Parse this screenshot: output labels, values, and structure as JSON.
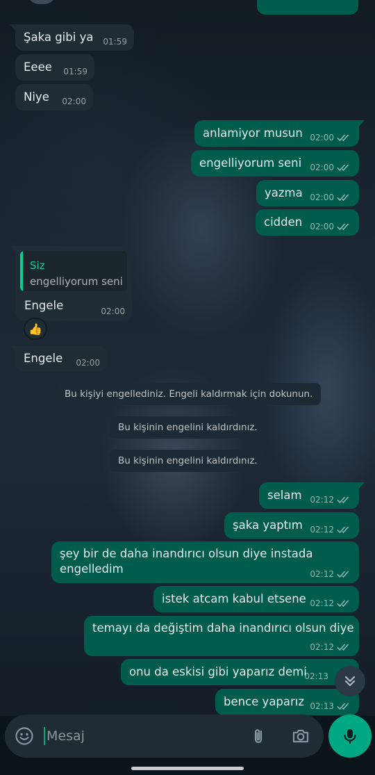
{
  "messages": [
    {
      "text": "Şaka gibi ya",
      "time": "01:59"
    },
    {
      "text": "Eeee",
      "time": "01:59"
    },
    {
      "text": "Niye",
      "time": "02:00"
    },
    {
      "text": "anlamiyor musun",
      "time": "02:00"
    },
    {
      "text": "engelliyorum seni",
      "time": "02:00"
    },
    {
      "text": "yazma",
      "time": "02:00"
    },
    {
      "text": "cidden",
      "time": "02:00"
    },
    {
      "quote_author": "Siz",
      "quote_text": "engelliyorum seni",
      "text": "Engele",
      "time": "02:00",
      "reaction": "👍"
    },
    {
      "text": "Engele",
      "time": "02:00"
    },
    {
      "text": "selam",
      "time": "02:12"
    },
    {
      "text": "şaka yaptım",
      "time": "02:12"
    },
    {
      "text": "şey bir de daha inandırıcı olsun diye instada engelledim",
      "line1": "şey bir de daha inandırıcı olsun diye instada",
      "line2": "engelledim",
      "time": "02:12"
    },
    {
      "text": "istek atcam kabul etsene",
      "time": "02:12"
    },
    {
      "text": "temayı da değiştim daha inandırıcı olsun diye",
      "time": "02:12"
    },
    {
      "text": "onu da eskisi gibi yaparız demi",
      "time": "02:13"
    },
    {
      "text": "bence yaparız",
      "time": "02:13"
    }
  ],
  "system_notices": [
    "Bu kişiyi engellediniz. Engeli kaldırmak için dokunun.",
    "Bu kişinin engelini kaldırdınız.",
    "Bu kişinin engelini kaldırdınız."
  ],
  "composer": {
    "placeholder": "Mesaj"
  },
  "icons": {
    "emoji": "smiley-icon",
    "attach": "paperclip-icon",
    "camera": "camera-icon",
    "mic": "microphone-icon",
    "scroll": "double-chevron-down-icon",
    "read": "double-check-icon"
  },
  "colors": {
    "incoming_bubble": "#1f2c34",
    "outgoing_bubble": "#005c4b",
    "accent": "#00a884",
    "quote_author": "#06cf9c"
  }
}
